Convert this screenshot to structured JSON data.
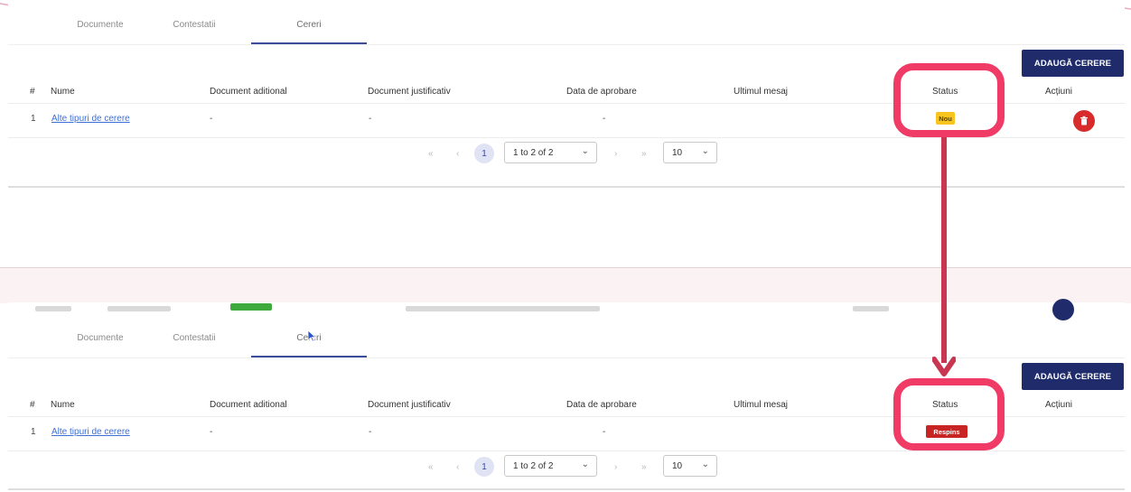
{
  "tabs": [
    "Documente",
    "Contestatii",
    "Cereri"
  ],
  "tabs_bottom": [
    "Documente",
    "Contestatii",
    "Cereri"
  ],
  "add_button": "ADAUGĂ CERERE",
  "columns": [
    "#",
    "Nume",
    "Document aditional",
    "Document justificativ",
    "Data de aprobare",
    "Ultimul mesaj",
    "Status",
    "Acțiuni"
  ],
  "top_table": {
    "row": {
      "index": "1",
      "name": "Alte tipuri de cerere",
      "doc_aditional": "-",
      "doc_justificativ": "-",
      "data_aprobare": "-",
      "status": "Nou"
    }
  },
  "bottom_table": {
    "row": {
      "index": "1",
      "name": "Alte tipuri de cerere",
      "doc_aditional": "-",
      "doc_justificativ": "-",
      "data_aprobare": "-",
      "status": "Respins"
    }
  },
  "pagination": {
    "first": "«",
    "prev": "‹",
    "page": "1",
    "range": "1 to 2 of 2",
    "next": "›",
    "last": "»",
    "page_size": "10"
  },
  "colors": {
    "accent": "#1f2b6b",
    "status_new": "#f7c51d",
    "status_rejected": "#c92424",
    "highlight": "#ef3b65",
    "link": "#3d6fd6",
    "delete": "#d82b2b"
  },
  "icons": [
    "trash-icon",
    "chevron-down-icon",
    "cursor-icon"
  ]
}
